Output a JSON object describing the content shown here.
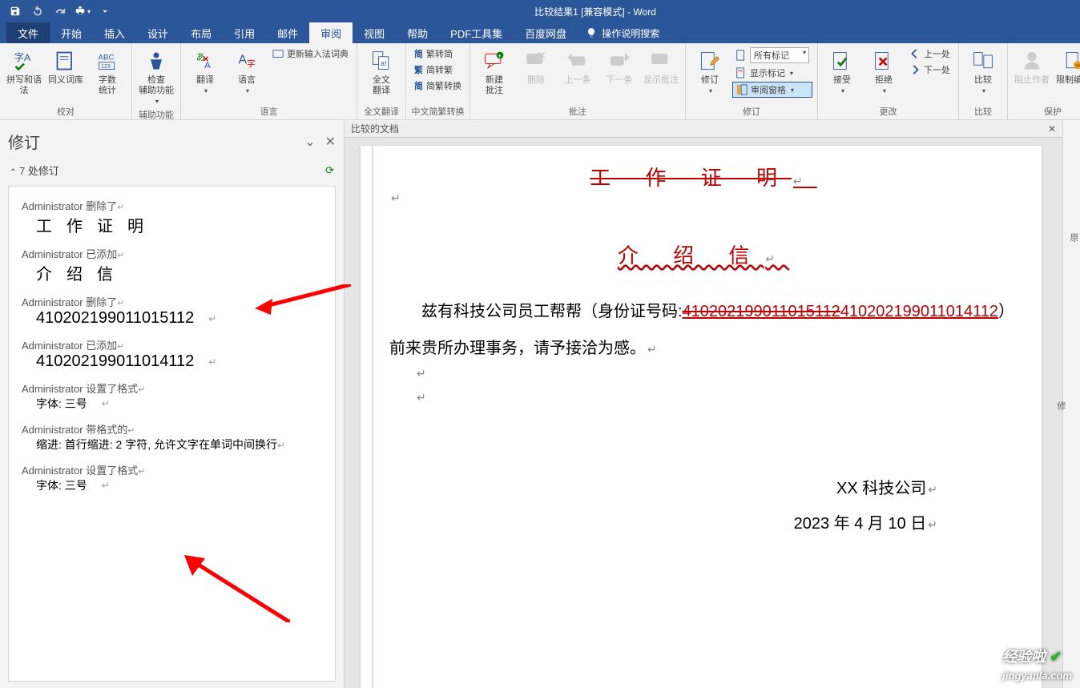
{
  "window": {
    "title": "比较结果1 [兼容模式] - Word"
  },
  "tabs": {
    "file": "文件",
    "home": "开始",
    "insert": "插入",
    "design": "设计",
    "layout": "布局",
    "references": "引用",
    "mailings": "邮件",
    "review": "审阅",
    "view": "视图",
    "help": "帮助",
    "pdftools": "PDF工具集",
    "baidu": "百度网盘",
    "tellme": "操作说明搜索"
  },
  "ribbon": {
    "proofing": {
      "spell": "拼写和语法",
      "thesaurus": "同义词库",
      "wordcount_l1": "字数",
      "wordcount_l2": "统计",
      "group": "校对"
    },
    "accessibility": {
      "check_l1": "检查",
      "check_l2": "辅助功能",
      "group": "辅助功能"
    },
    "language": {
      "update_ime": "更新输入法词典",
      "translate": "翻译",
      "language": "语言",
      "group": "语言"
    },
    "fulltext": {
      "l1": "全文",
      "l2": "翻译",
      "group": "全文翻译"
    },
    "chinese": {
      "sc": "繁转简",
      "tc": "简转繁",
      "conv": "简繁转换",
      "group": "中文简繁转换"
    },
    "comments": {
      "new_l1": "新建",
      "new_l2": "批注",
      "delete": "删除",
      "prev": "上一条",
      "next": "下一条",
      "show": "显示批注",
      "group": "批注"
    },
    "tracking": {
      "track": "修订",
      "all_markup": "所有标记",
      "show_markup": "显示标记",
      "reviewing_pane": "审阅窗格",
      "group": "修订"
    },
    "changes": {
      "accept": "接受",
      "reject": "拒绝",
      "prev": "上一处",
      "next": "下一处",
      "group": "更改"
    },
    "compare": {
      "compare": "比较",
      "group": "比较"
    },
    "protect": {
      "block": "阻止作者",
      "restrict": "限制编辑",
      "group": "保护"
    }
  },
  "rev_pane": {
    "title": "修订",
    "count_label": "7 处修订",
    "items": [
      {
        "meta": "Administrator 删除了",
        "content": [
          "工",
          "作",
          "证",
          "明"
        ],
        "style": "spread"
      },
      {
        "meta": "Administrator 已添加",
        "content": [
          "介",
          "绍",
          "信"
        ],
        "style": "spread"
      },
      {
        "meta": "Administrator 删除了",
        "content_text": "410202199011015112",
        "style": "mono"
      },
      {
        "meta": "Administrator 已添加",
        "content_text": "410202199011014112",
        "style": "mono"
      },
      {
        "meta": "Administrator 设置了格式",
        "content_text": "字体: 三号",
        "style": "small"
      },
      {
        "meta": "Administrator 带格式的",
        "content_text": "缩进: 首行缩进:  2 字符, 允许文字在单词中间换行",
        "style": "small"
      },
      {
        "meta": "Administrator 设置了格式",
        "content_text": "字体: 三号",
        "style": "small"
      }
    ]
  },
  "doc": {
    "compared_label": "比较的文档",
    "title_old": "工 作 证 明",
    "title_new": "介 绍 信",
    "body_pre": "兹有科技公司员工帮帮（身份证号码:",
    "id_old": "410202199011015112",
    "id_new": "410202199011014112",
    "body_post": "）前来贵所办理事务，请予接洽为感。",
    "company": "XX 科技公司",
    "date": "2023 年 4 月 10 日"
  },
  "right_rail": {
    "orig": "原",
    "rev": "修"
  },
  "watermark": "jingyanla.com",
  "watermark_pre": "经验啦"
}
